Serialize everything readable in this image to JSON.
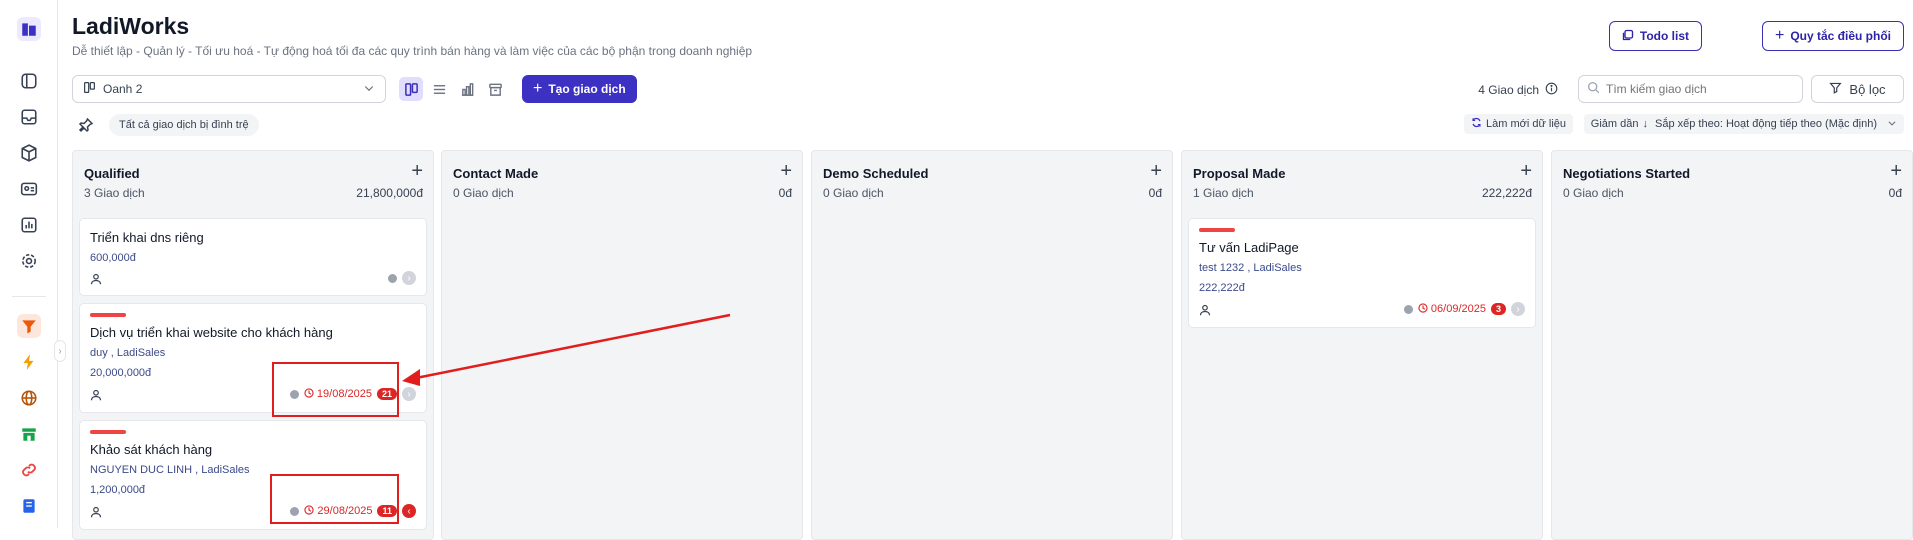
{
  "app": {
    "title": "LadiWorks",
    "subtitle": "Dễ thiết lập - Quản lý - Tối ưu hoá - Tự động hoá tối đa các quy trình bán hàng và làm việc của các bộ phận trong doanh nghiệp"
  },
  "sidebar": {
    "icons": [
      "building-icon",
      "layout-icon",
      "inbox-icon",
      "box-icon",
      "contact-card-icon",
      "report-icon",
      "settings-icon",
      "funnel-icon",
      "bolt-icon",
      "globe-icon",
      "store-icon",
      "link-icon",
      "book-icon"
    ]
  },
  "header": {
    "todo_label": "Todo list",
    "rules_label": "Quy tắc điều phối"
  },
  "toolbar": {
    "pipeline_value": "Oanh 2",
    "create_label": "Tạo giao dịch",
    "deal_count": "4 Giao dịch",
    "search_placeholder": "Tìm kiếm giao dịch",
    "filter_label": "Bộ lọc",
    "pinned_chip": "Tất cả giao dịch bị đình trệ",
    "refresh_label": "Làm mới dữ liệu",
    "sort_dir_label": "Giảm dần",
    "sort_by_label": "Sắp xếp theo: Hoạt động tiếp theo (Mặc định)"
  },
  "columns": [
    {
      "title": "Qualified",
      "count": "3 Giao dịch",
      "total": "21,800,000đ",
      "cards": [
        {
          "title": "Triển khai dns riêng",
          "sub": "",
          "amount": "600,000đ",
          "date": "",
          "badge": ""
        },
        {
          "title": "Dịch vụ triển khai website cho khách hàng",
          "sub": "duy , LadiSales",
          "amount": "20,000,000đ",
          "date": "19/08/2025",
          "badge": "21"
        },
        {
          "title": "Khảo sát khách hàng",
          "sub": "NGUYEN DUC LINH , LadiSales",
          "amount": "1,200,000đ",
          "date": "29/08/2025",
          "badge": "11"
        }
      ]
    },
    {
      "title": "Contact Made",
      "count": "0 Giao dịch",
      "total": "0đ",
      "cards": []
    },
    {
      "title": "Demo Scheduled",
      "count": "0 Giao dịch",
      "total": "0đ",
      "cards": []
    },
    {
      "title": "Proposal Made",
      "count": "1 Giao dịch",
      "total": "222,222đ",
      "cards": [
        {
          "title": "Tư vấn LadiPage",
          "sub": "test 1232 , LadiSales",
          "amount": "222,222đ",
          "date": "06/09/2025",
          "badge": "3"
        }
      ]
    },
    {
      "title": "Negotiations Started",
      "count": "0 Giao dịch",
      "total": "0đ",
      "cards": []
    }
  ],
  "colors": {
    "primary": "#3d31c4",
    "danger": "#dc2626",
    "annotation": "#e11d1d"
  }
}
